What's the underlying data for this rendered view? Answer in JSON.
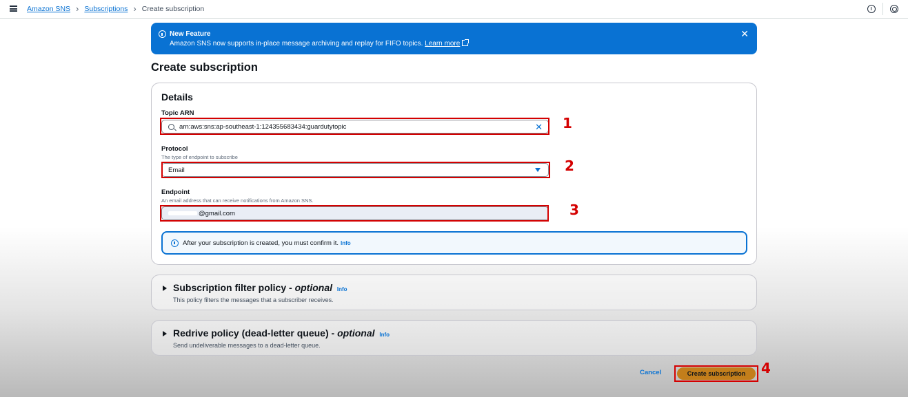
{
  "breadcrumb": {
    "items": [
      "Amazon SNS",
      "Subscriptions"
    ],
    "current": "Create subscription"
  },
  "flash": {
    "title": "New Feature",
    "message": "Amazon SNS now supports in-place message archiving and replay for FIFO topics.",
    "link": "Learn more"
  },
  "page": {
    "title": "Create subscription"
  },
  "details": {
    "heading": "Details",
    "topic_arn": {
      "label": "Topic ARN",
      "value": "arn:aws:sns:ap-southeast-1:124355683434:guardutytopic"
    },
    "protocol": {
      "label": "Protocol",
      "description": "The type of endpoint to subscribe",
      "value": "Email"
    },
    "endpoint": {
      "label": "Endpoint",
      "description": "An email address that can receive notifications from Amazon SNS.",
      "value": "@gmail.com"
    },
    "alert": {
      "text": "After your subscription is created, you must confirm it.",
      "info": "Info"
    }
  },
  "sections": [
    {
      "title": "Subscription filter policy - ",
      "optional": "optional",
      "info": "Info",
      "description": "This policy filters the messages that a subscriber receives."
    },
    {
      "title": "Redrive policy (dead-letter queue) - ",
      "optional": "optional",
      "info": "Info",
      "description": "Send undeliverable messages to a dead-letter queue."
    }
  ],
  "actions": {
    "cancel": "Cancel",
    "create": "Create subscription"
  },
  "annotations": [
    "1",
    "2",
    "3",
    "4"
  ],
  "colors": {
    "accent": "#0972d3",
    "primary_button": "#c37e1b",
    "annotation": "#d40000"
  }
}
